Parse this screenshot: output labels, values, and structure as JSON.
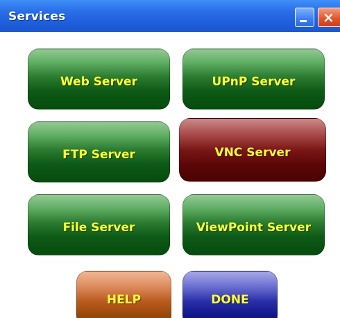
{
  "window": {
    "title": "Services",
    "minimize_icon": "minimize-icon",
    "close_icon": "close-icon",
    "close_glyph": "×"
  },
  "buttons": {
    "web_server": "Web Server",
    "upnp_server": "UPnP Server",
    "ftp_server": "FTP Server",
    "vnc_server": "VNC Server",
    "file_server": "File Server",
    "viewpoint_server": "ViewPoint Server",
    "help": "HELP",
    "done": "DONE"
  },
  "colors": {
    "titlebar": "#2a6ee8",
    "green": "#0d5a16",
    "red": "#5a0606",
    "orange": "#b95b1f",
    "blue": "#12178a",
    "label": "#ffff33"
  }
}
